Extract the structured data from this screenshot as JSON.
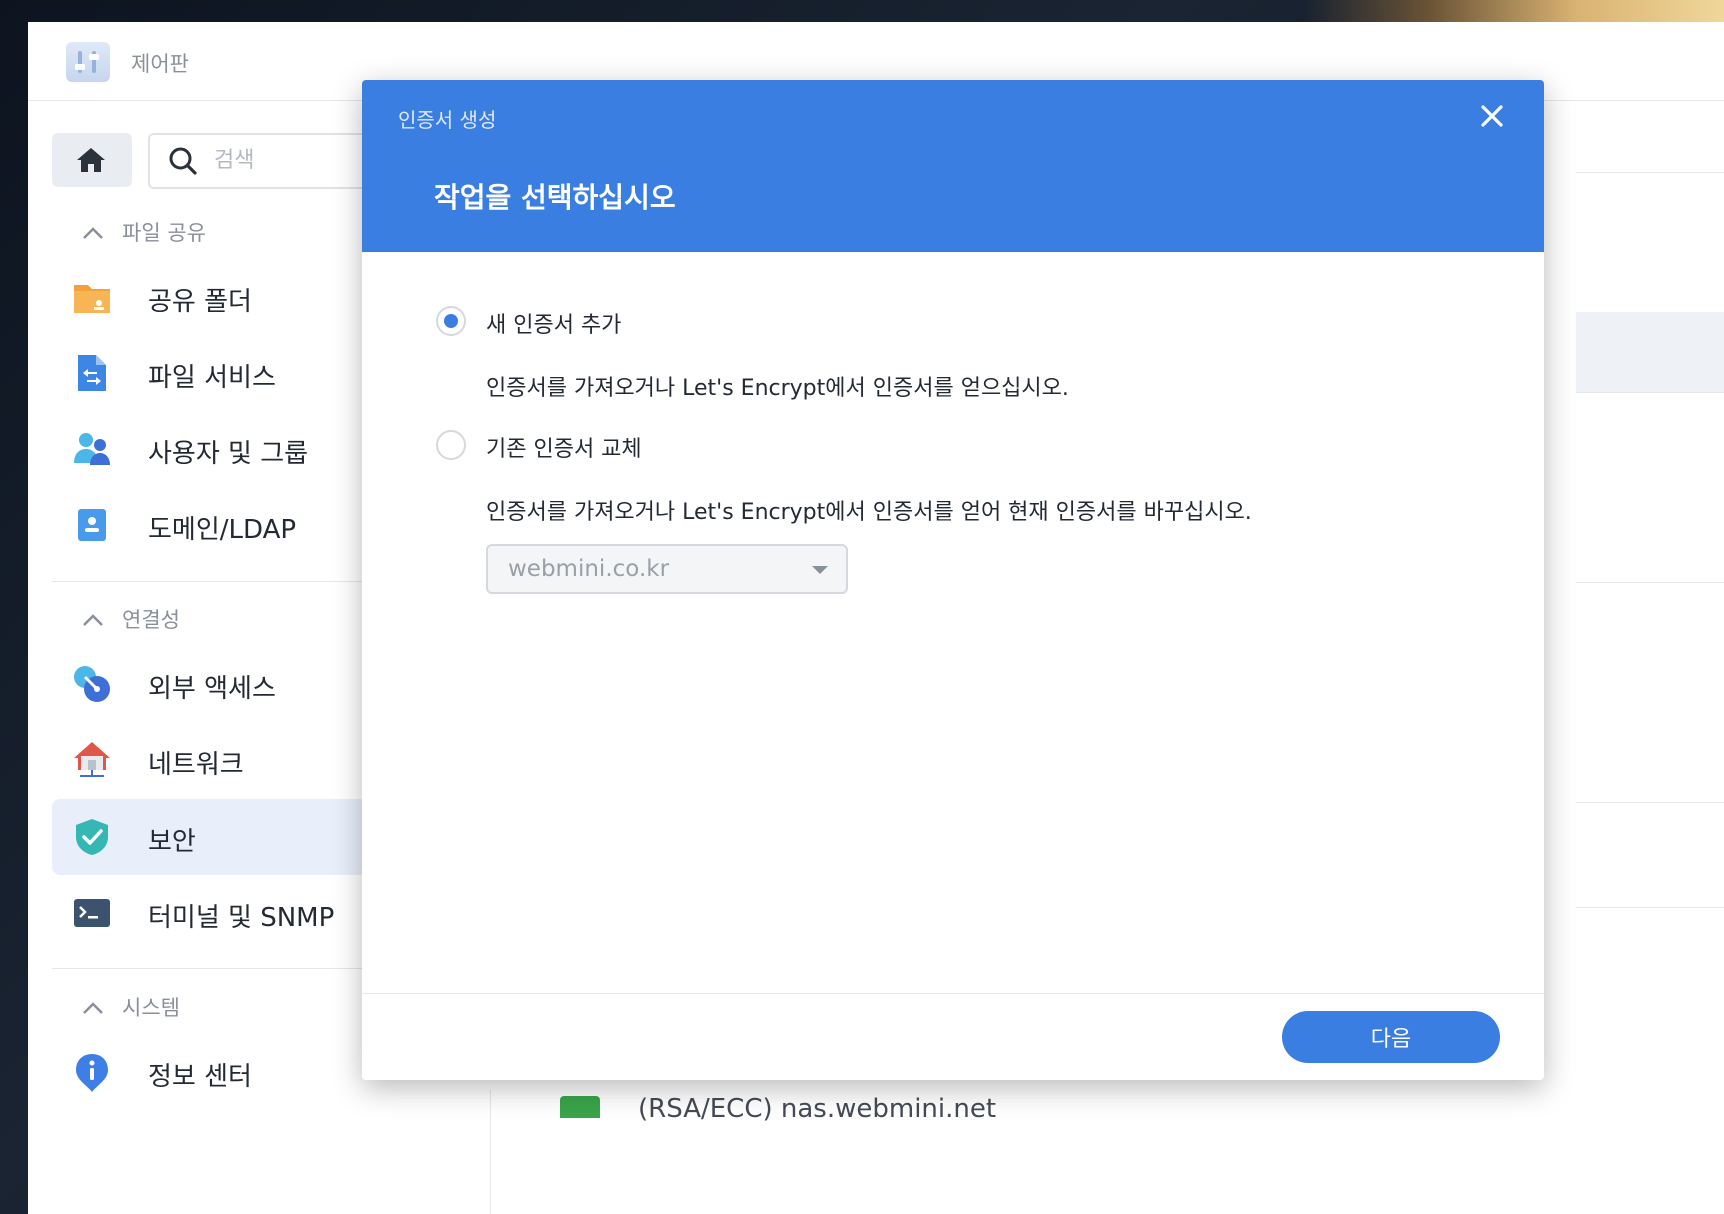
{
  "window": {
    "title": "제어판"
  },
  "search": {
    "placeholder": "검색"
  },
  "sidebar": {
    "sections": [
      {
        "label": "파일 공유",
        "items": [
          {
            "label": "공유 폴더"
          },
          {
            "label": "파일 서비스"
          },
          {
            "label": "사용자 및 그룹"
          },
          {
            "label": "도메인/LDAP"
          }
        ]
      },
      {
        "label": "연결성",
        "items": [
          {
            "label": "외부 액세스"
          },
          {
            "label": "네트워크"
          },
          {
            "label": "보안",
            "active": true
          },
          {
            "label": "터미널 및 SNMP"
          }
        ]
      },
      {
        "label": "시스템",
        "items": [
          {
            "label": "정보 센터"
          }
        ]
      }
    ]
  },
  "background": {
    "footer_text": "(RSA/ECC) nas.webmini.net"
  },
  "dialog": {
    "title": "인증서 생성",
    "heading": "작업을 선택하십시오",
    "options": [
      {
        "label": "새 인증서 추가",
        "description": "인증서를 가져오거나 Let's Encrypt에서 인증서를 얻으십시오.",
        "checked": true
      },
      {
        "label": "기존 인증서 교체",
        "description": "인증서를 가져오거나 Let's Encrypt에서 인증서를 얻어 현재 인증서를 바꾸십시오.",
        "checked": false
      }
    ],
    "select": {
      "value": "webmini.co.kr"
    },
    "next_label": "다음"
  },
  "colors": {
    "accent": "#3a7ee1",
    "active_bg": "#e8eefa"
  }
}
